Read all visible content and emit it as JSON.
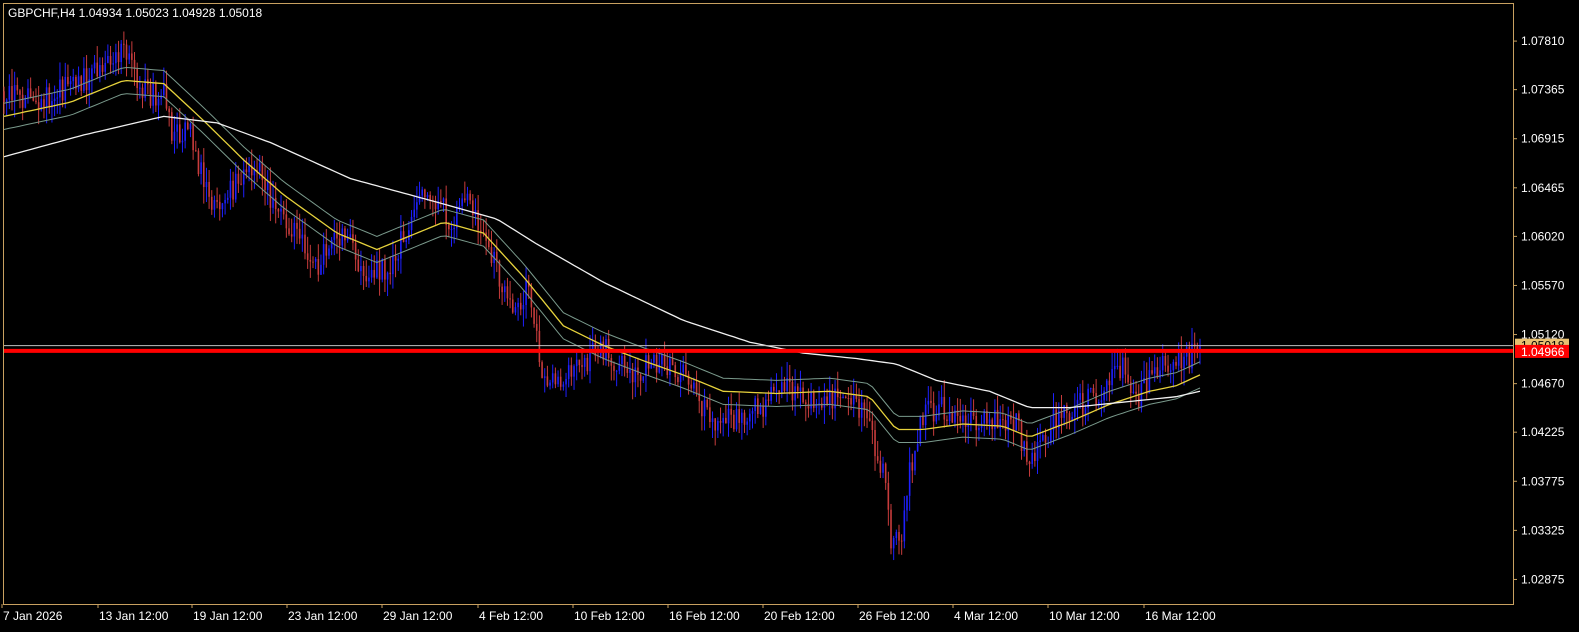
{
  "symbol_header": {
    "text": "GBPCHF,H4  1.04934 1.05023 1.04928 1.05018"
  },
  "colors": {
    "background": "#000000",
    "frame": "#C8A060",
    "text": "#FFFFFF",
    "bull_candle": "#1E20FF",
    "bear_candle": "#C83C3C",
    "ema_fast": "#E6D23C",
    "envelope": "#7A9A8C",
    "ema_slow": "#F0F0F0",
    "resistance_line": "#FF0000",
    "price_line": "#C0C0C0",
    "current_price_tag": "#E8C070"
  },
  "chart_data": {
    "type": "line",
    "title": "GBPCHF,H4  1.04934 1.05023 1.04928 1.05018",
    "xlabel": "",
    "ylabel": "",
    "ylim": [
      1.0265,
      1.0815
    ],
    "x_tick_labels": [
      "7 Jan 2026",
      "13 Jan 12:00",
      "19 Jan 12:00",
      "23 Jan 12:00",
      "29 Jan 12:00",
      "4 Feb 12:00",
      "10 Feb 12:00",
      "16 Feb 12:00",
      "20 Feb 12:00",
      "26 Feb 12:00",
      "4 Mar 12:00",
      "10 Mar 12:00",
      "16 Mar 12:00"
    ],
    "y_tick_labels": [
      "1.07810",
      "1.07365",
      "1.06915",
      "1.06465",
      "1.06020",
      "1.05570",
      "1.05120",
      "1.04670",
      "1.04225",
      "1.03775",
      "1.03325",
      "1.02875"
    ],
    "y_tick_values": [
      1.0781,
      1.07365,
      1.06915,
      1.06465,
      1.0602,
      1.0557,
      1.0512,
      1.0467,
      1.04225,
      1.03775,
      1.03325,
      1.02875
    ],
    "price_anchors": [
      [
        0,
        1.0735
      ],
      [
        15,
        1.0728
      ],
      [
        30,
        1.0745
      ],
      [
        40,
        1.076
      ],
      [
        45,
        1.0778
      ],
      [
        50,
        1.0747
      ],
      [
        55,
        1.0732
      ],
      [
        60,
        1.0735
      ],
      [
        63,
        1.0692
      ],
      [
        70,
        1.0697
      ],
      [
        75,
        1.0652
      ],
      [
        80,
        1.0622
      ],
      [
        90,
        1.0662
      ],
      [
        95,
        1.0668
      ],
      [
        100,
        1.0638
      ],
      [
        110,
        1.0602
      ],
      [
        118,
        1.0575
      ],
      [
        125,
        1.0605
      ],
      [
        130,
        1.0595
      ],
      [
        135,
        1.0567
      ],
      [
        145,
        1.0575
      ],
      [
        155,
        1.0632
      ],
      [
        160,
        1.0637
      ],
      [
        168,
        1.0618
      ],
      [
        175,
        1.0635
      ],
      [
        185,
        1.0572
      ],
      [
        190,
        1.0535
      ],
      [
        197,
        1.0555
      ],
      [
        203,
        1.0465
      ],
      [
        210,
        1.0475
      ],
      [
        215,
        1.0485
      ],
      [
        225,
        1.0498
      ],
      [
        235,
        1.0478
      ],
      [
        245,
        1.0485
      ],
      [
        255,
        1.0478
      ],
      [
        265,
        1.0435
      ],
      [
        275,
        1.0435
      ],
      [
        285,
        1.0448
      ],
      [
        295,
        1.0462
      ],
      [
        305,
        1.0445
      ],
      [
        315,
        1.0458
      ],
      [
        320,
        1.045
      ],
      [
        325,
        1.0425
      ],
      [
        330,
        1.039
      ],
      [
        333,
        1.0315
      ],
      [
        337,
        1.0325
      ],
      [
        340,
        1.0385
      ],
      [
        345,
        1.0438
      ],
      [
        352,
        1.0445
      ],
      [
        360,
        1.0438
      ],
      [
        370,
        1.0432
      ],
      [
        380,
        1.0428
      ],
      [
        385,
        1.0395
      ],
      [
        390,
        1.041
      ],
      [
        395,
        1.0438
      ],
      [
        405,
        1.0448
      ],
      [
        415,
        1.0465
      ],
      [
        420,
        1.0485
      ],
      [
        425,
        1.0448
      ],
      [
        430,
        1.0475
      ],
      [
        438,
        1.0485
      ],
      [
        445,
        1.0492
      ],
      [
        449,
        1.0501
      ]
    ],
    "ema_fast_anchors": [
      [
        0,
        1.0712
      ],
      [
        25,
        1.0725
      ],
      [
        45,
        1.0745
      ],
      [
        60,
        1.0742
      ],
      [
        75,
        1.0708
      ],
      [
        90,
        1.0672
      ],
      [
        105,
        1.064
      ],
      [
        125,
        1.0605
      ],
      [
        140,
        1.059
      ],
      [
        155,
        1.0605
      ],
      [
        165,
        1.0615
      ],
      [
        180,
        1.0605
      ],
      [
        195,
        1.0565
      ],
      [
        210,
        1.052
      ],
      [
        225,
        1.0502
      ],
      [
        240,
        1.0488
      ],
      [
        255,
        1.0475
      ],
      [
        270,
        1.046
      ],
      [
        290,
        1.0458
      ],
      [
        310,
        1.046
      ],
      [
        325,
        1.0455
      ],
      [
        335,
        1.0425
      ],
      [
        345,
        1.0425
      ],
      [
        360,
        1.043
      ],
      [
        375,
        1.0428
      ],
      [
        385,
        1.0418
      ],
      [
        400,
        1.0432
      ],
      [
        415,
        1.0448
      ],
      [
        430,
        1.046
      ],
      [
        440,
        1.0465
      ],
      [
        449,
        1.0475
      ]
    ],
    "ema_slow_anchors": [
      [
        0,
        1.0675
      ],
      [
        30,
        1.0695
      ],
      [
        60,
        1.0712
      ],
      [
        80,
        1.0706
      ],
      [
        100,
        1.0688
      ],
      [
        130,
        1.0655
      ],
      [
        160,
        1.0635
      ],
      [
        185,
        1.0618
      ],
      [
        200,
        1.0595
      ],
      [
        225,
        1.056
      ],
      [
        255,
        1.0525
      ],
      [
        280,
        1.0505
      ],
      [
        300,
        1.0495
      ],
      [
        320,
        1.049
      ],
      [
        335,
        1.0485
      ],
      [
        350,
        1.047
      ],
      [
        370,
        1.046
      ],
      [
        385,
        1.0445
      ],
      [
        400,
        1.0445
      ],
      [
        420,
        1.045
      ],
      [
        440,
        1.0455
      ],
      [
        449,
        1.046
      ]
    ],
    "envelope_deviation": 0.0012,
    "candle_count": 450,
    "resistance_level": 1.0497,
    "current_price": 1.05018,
    "current_price_label": "1.05018",
    "resistance_label": "1.04966",
    "grid": false
  }
}
